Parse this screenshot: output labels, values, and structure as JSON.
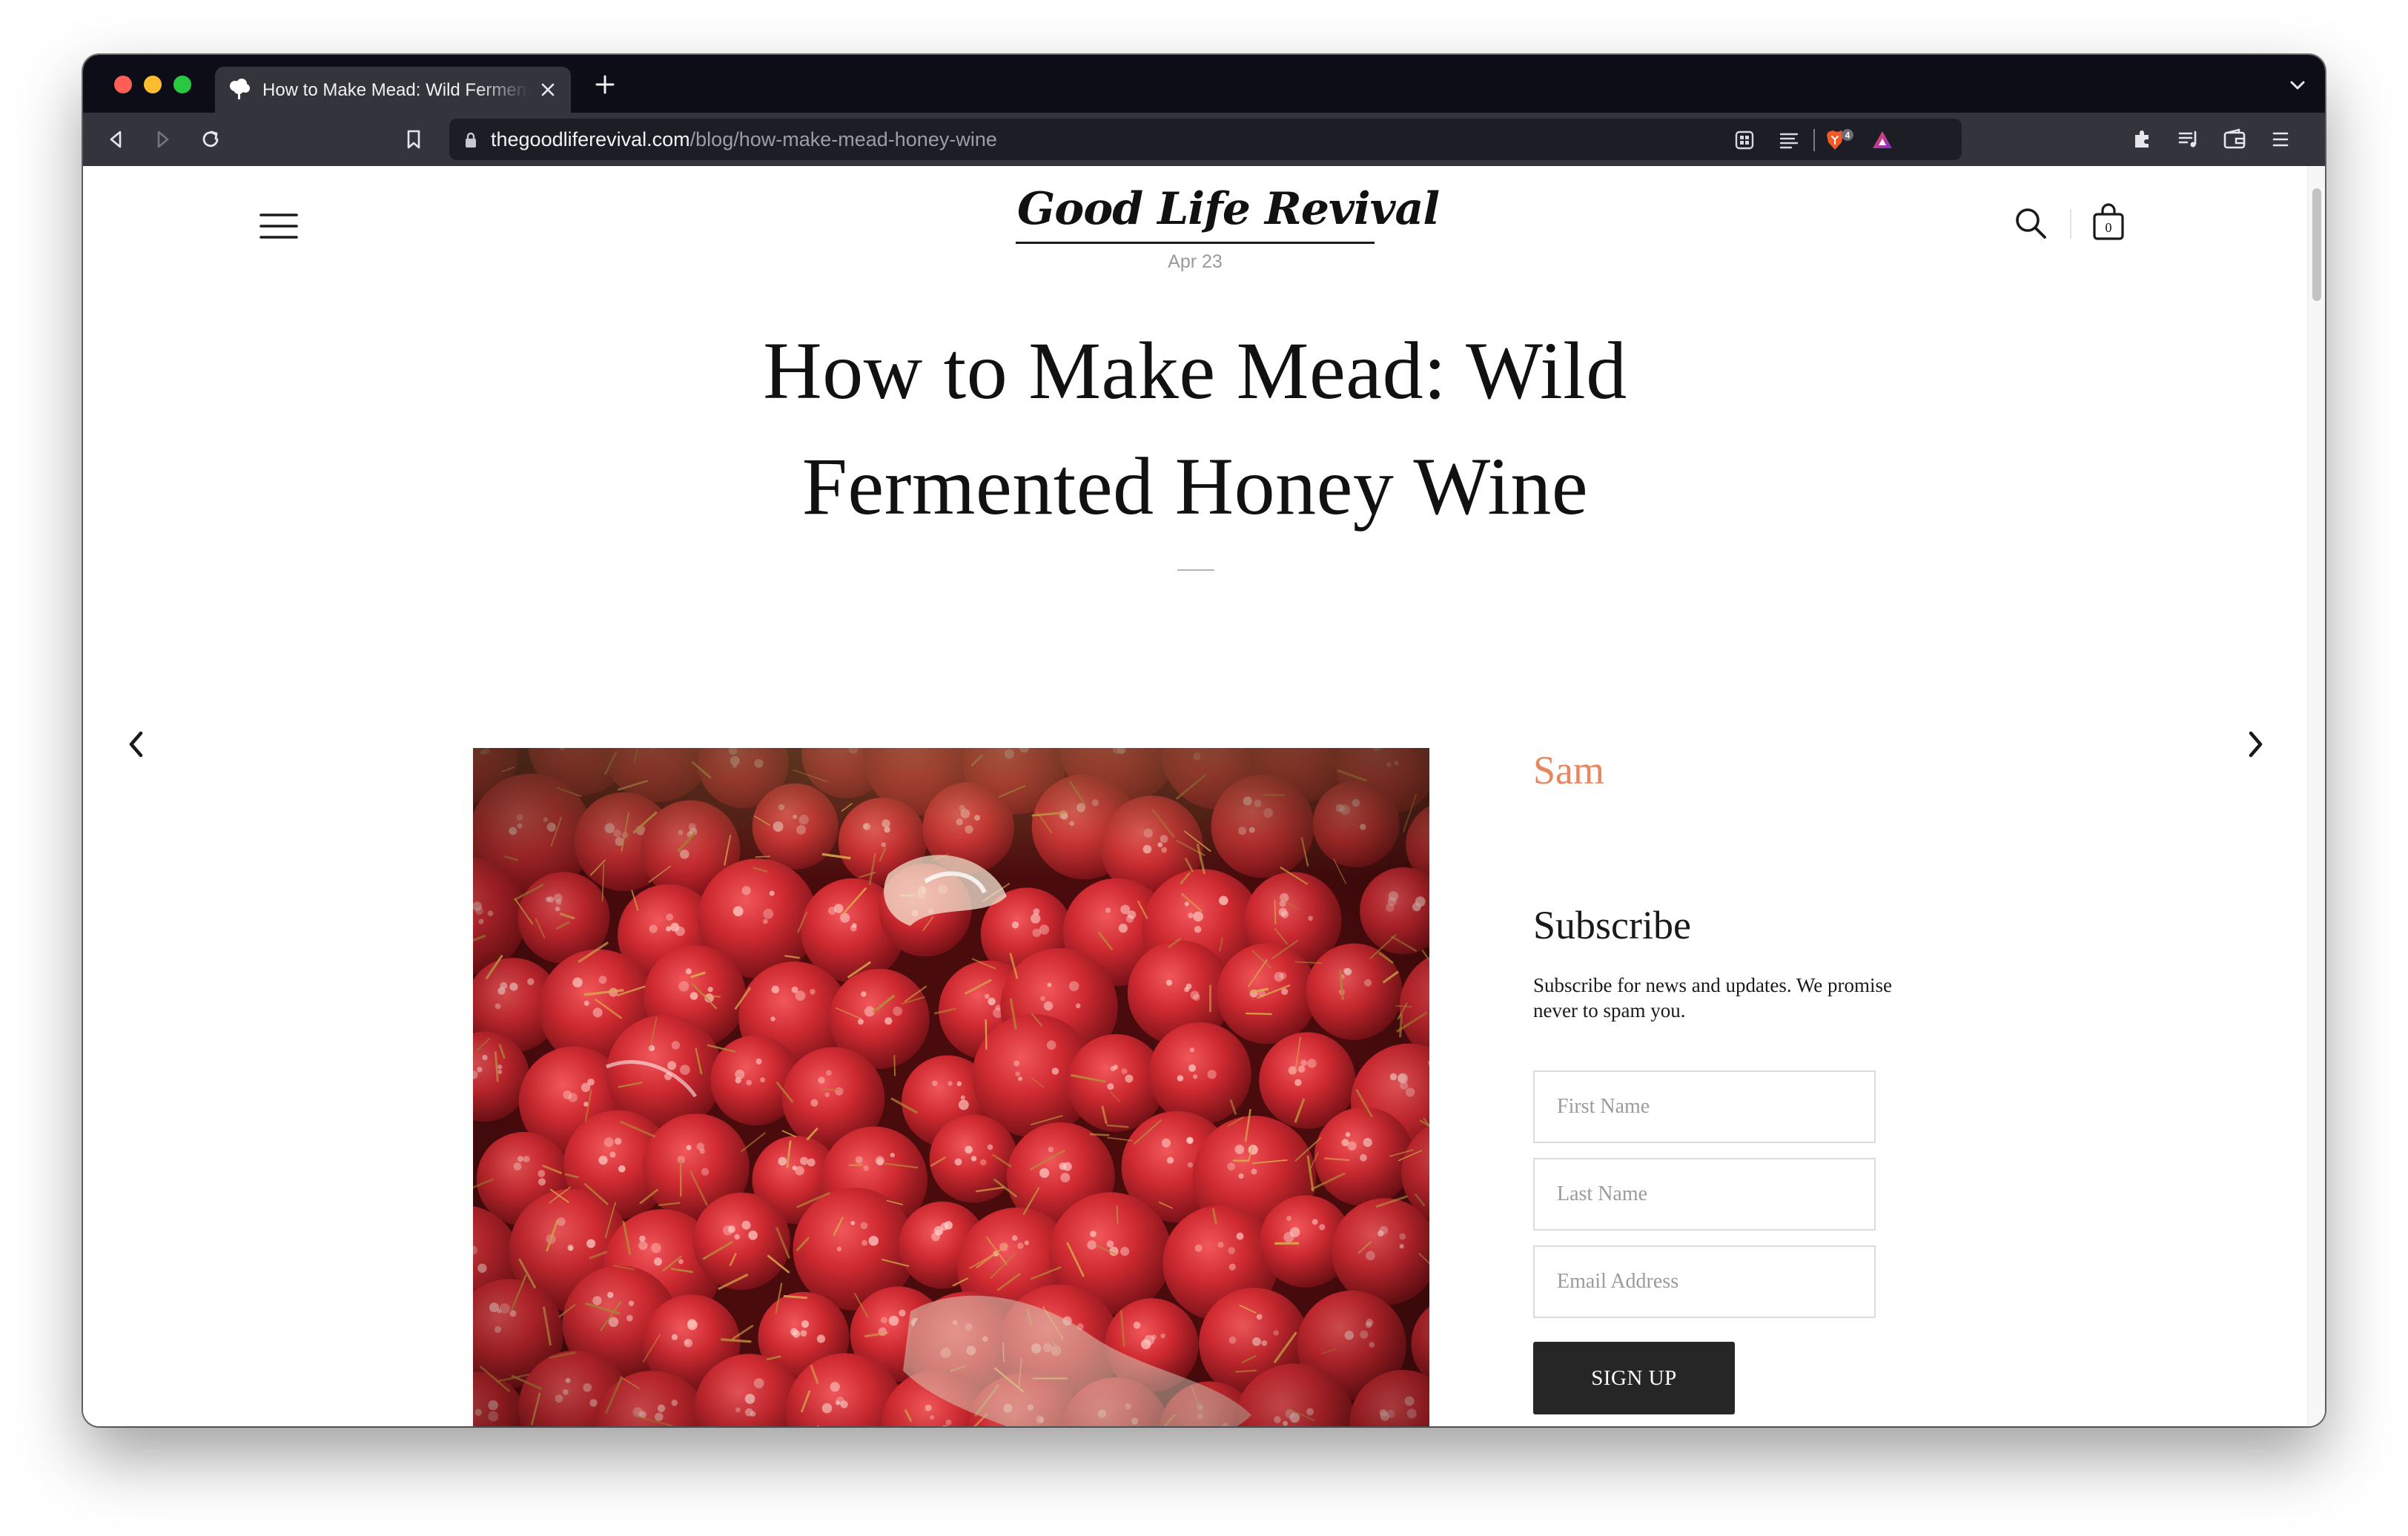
{
  "browser": {
    "tab_title": "How to Make Mead: Wild Fermented Honey Wine",
    "url_host": "thegoodliferevival.com",
    "url_path": "/blog/how-make-mead-honey-wine",
    "shields_count": "4"
  },
  "site": {
    "logo": "Good Life Revival",
    "cart_count": "0"
  },
  "post": {
    "date": "Apr 23",
    "title": "How to Make Mead: Wild Fermented Honey Wine",
    "author": "Sam"
  },
  "subscribe": {
    "heading": "Subscribe",
    "text": "Subscribe for news and updates. We promise never to spam you.",
    "first_name_placeholder": "First Name",
    "last_name_placeholder": "Last Name",
    "email_placeholder": "Email Address",
    "button_label": "SIGN UP"
  },
  "icons": {
    "nav_menu": "hamburger-menu-icon",
    "search": "search-icon",
    "cart": "shopping-bag-icon",
    "prev": "chevron-left-icon",
    "next": "chevron-right-icon"
  },
  "colors": {
    "author_accent": "#e8865e",
    "signup_button": "#262626",
    "browser_chrome": "#34343d",
    "tab_strip": "#0d0d17"
  }
}
